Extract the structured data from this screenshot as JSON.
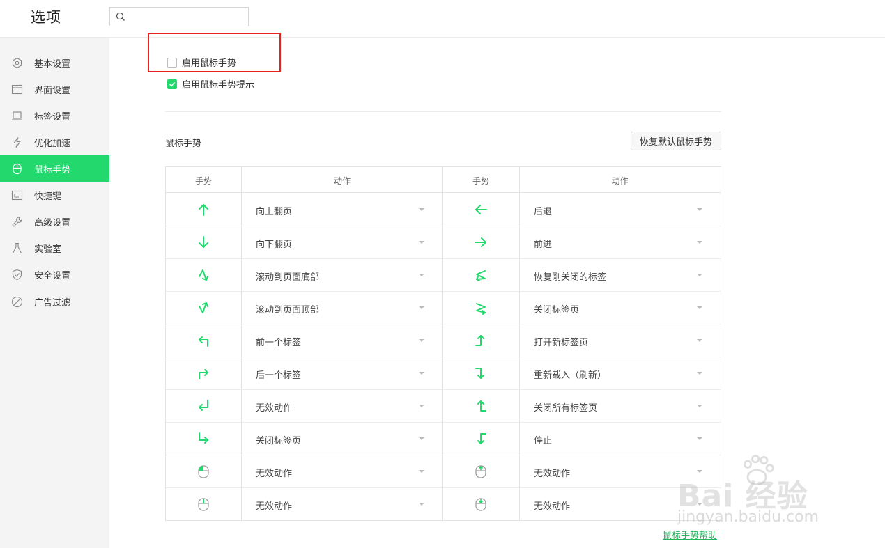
{
  "header": {
    "title": "选项",
    "search_value": ""
  },
  "sidebar": {
    "items": [
      {
        "label": "基本设置",
        "icon": "gear-icon"
      },
      {
        "label": "界面设置",
        "icon": "window-icon"
      },
      {
        "label": "标签设置",
        "icon": "tab-icon"
      },
      {
        "label": "优化加速",
        "icon": "lightning-icon"
      },
      {
        "label": "鼠标手势",
        "icon": "mouse-icon"
      },
      {
        "label": "快捷键",
        "icon": "keyboard-icon"
      },
      {
        "label": "高级设置",
        "icon": "wrench-icon"
      },
      {
        "label": "实验室",
        "icon": "flask-icon"
      },
      {
        "label": "安全设置",
        "icon": "shield-icon"
      },
      {
        "label": "广告过滤",
        "icon": "block-icon"
      }
    ],
    "active_index": 4
  },
  "options": {
    "enable_gesture": {
      "label": "启用鼠标手势",
      "checked": false
    },
    "enable_gesture_hint": {
      "label": "启用鼠标手势提示",
      "checked": true
    }
  },
  "gestures": {
    "section_title": "鼠标手势",
    "reset_label": "恢复默认鼠标手势",
    "headers": {
      "gesture": "手势",
      "action": "动作"
    },
    "rows": [
      {
        "left_icon": "arrow-up-icon",
        "left_action": "向上翻页",
        "right_icon": "arrow-left-icon",
        "right_action": "后退"
      },
      {
        "left_icon": "arrow-down-icon",
        "left_action": "向下翻页",
        "right_icon": "arrow-right-icon",
        "right_action": "前进"
      },
      {
        "left_icon": "zigzag-down-icon",
        "left_action": "滚动到页面底部",
        "right_icon": "zigzag-left-icon",
        "right_action": "恢复刚关闭的标签"
      },
      {
        "left_icon": "zigzag-up-icon",
        "left_action": "滚动到页面顶部",
        "right_icon": "zigzag-right-icon",
        "right_action": "关闭标签页"
      },
      {
        "left_icon": "up-left-icon",
        "left_action": "前一个标签",
        "right_icon": "right-up-icon",
        "right_action": "打开新标签页"
      },
      {
        "left_icon": "up-right-icon",
        "left_action": "后一个标签",
        "right_icon": "right-down-icon",
        "right_action": "重新载入（刷新）"
      },
      {
        "left_icon": "down-left-icon",
        "left_action": "无效动作",
        "right_icon": "left-up-icon",
        "right_action": "关闭所有标签页"
      },
      {
        "left_icon": "down-right-icon",
        "left_action": "关闭标签页",
        "right_icon": "left-down-icon",
        "right_action": "停止"
      },
      {
        "left_icon": "mouse-left-button-icon",
        "left_action": "无效动作",
        "right_icon": "mouse-wheel-up-icon",
        "right_action": "无效动作"
      },
      {
        "left_icon": "mouse-middle-button-icon",
        "left_action": "无效动作",
        "right_icon": "mouse-wheel-down-icon",
        "right_action": "无效动作"
      }
    ],
    "help_link": "鼠标手势帮助"
  },
  "watermark": {
    "brand": "Bai 经验",
    "url": "jingyan.baidu.com"
  },
  "colors": {
    "accent": "#23d96e",
    "highlight_box": "#e8231f",
    "link": "#23b35a"
  }
}
